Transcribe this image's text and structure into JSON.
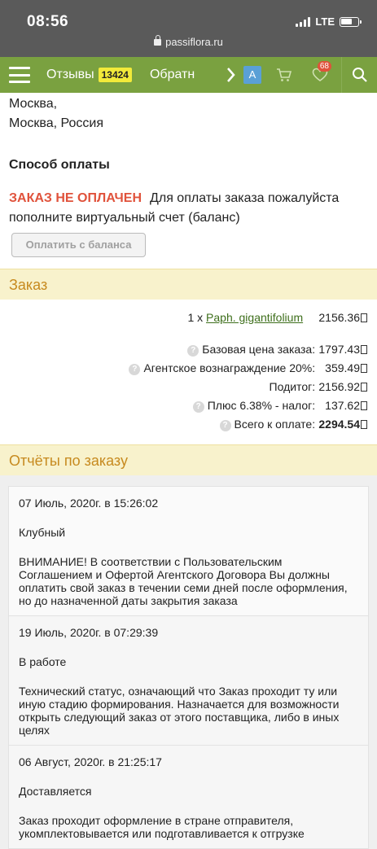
{
  "statusbar": {
    "time": "08:56",
    "network": "LTE",
    "url": "passiflora.ru"
  },
  "navbar": {
    "reviews_label": "Отзывы",
    "reviews_count": "13424",
    "feedback_label": "Обратн",
    "lang": "A",
    "favorites_count": "68"
  },
  "address": {
    "line1": "Москва,",
    "line2": "Москва, Россия"
  },
  "payment": {
    "title": "Способ оплаты",
    "status": "ЗАКАЗ НЕ ОПЛАЧЕН",
    "message": "Для оплаты заказа пожалуйста пополните виртуальный счет (баланс)",
    "button": "Оплатить с баланса"
  },
  "order": {
    "title": "Заказ",
    "item": {
      "qty": "1 x",
      "name": "Paph. gigantifolium",
      "price": "2156.36"
    },
    "summary": [
      {
        "label": "Базовая цена заказа:",
        "value": "1797.43",
        "help": true,
        "bold": false
      },
      {
        "label": "Агентское вознаграждение 20%:",
        "value": "359.49",
        "help": true,
        "bold": false
      },
      {
        "label": "Подитог:",
        "value": "2156.92",
        "help": false,
        "bold": false
      },
      {
        "label": "Плюс 6.38% - налог:",
        "value": "137.62",
        "help": true,
        "bold": false
      },
      {
        "label": "Всего к оплате:",
        "value": "2294.54",
        "help": true,
        "bold": true
      }
    ]
  },
  "reports": {
    "title": "Отчёты по заказу",
    "items": [
      {
        "date": "07 Июль, 2020г. в 15:26:02",
        "status": "Клубный",
        "text": "ВНИМАНИЕ! В соответствии с Пользовательским Соглашением и Офертой Агентского Договора Вы должны оплатить свой заказ в течении семи дней после оформления, но до назначенной даты закрытия заказа"
      },
      {
        "date": "19 Июль, 2020г. в 07:29:39",
        "status": "В работе",
        "text": "Технический статус, означающий что Заказ проходит ту или иную стадию формирования. Назначается для возможности открыть следующий заказ от этого поставщика, либо в иных целях"
      },
      {
        "date": "06 Август, 2020г. в 21:25:17",
        "status": "Доставляется",
        "text": "Заказ проходит оформление в стране отправителя, укомплектовывается или подготавливается к отгрузке"
      }
    ]
  },
  "colors": {
    "nav": "#7aa140",
    "accent": "#e0523b",
    "band": "#f8f2cc",
    "band_text": "#c78a1f"
  }
}
